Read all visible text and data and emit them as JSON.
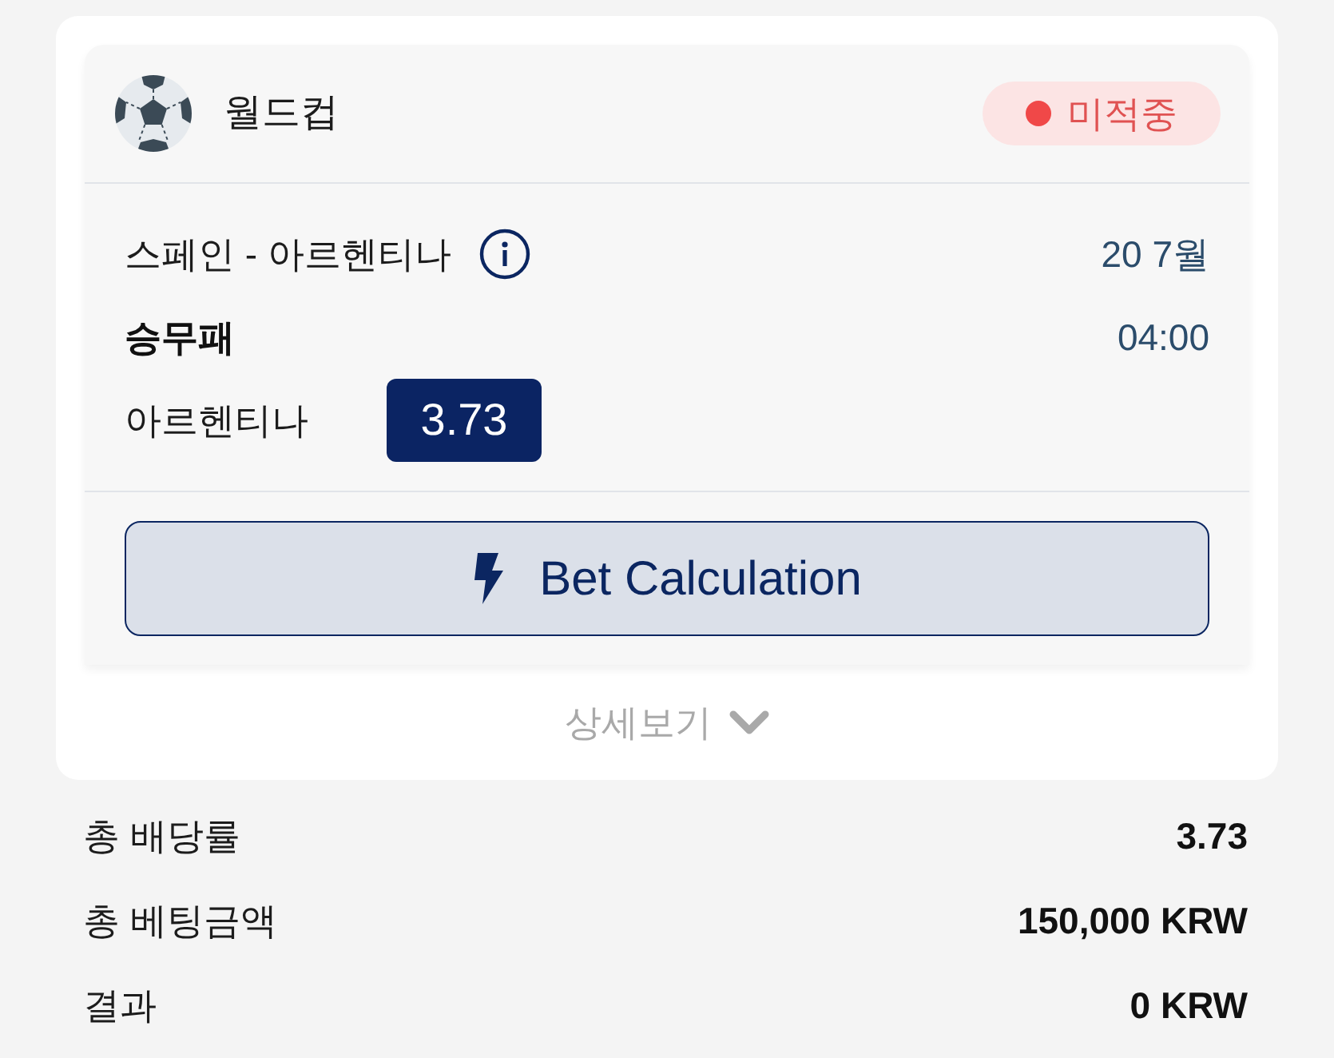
{
  "card": {
    "league": {
      "title": "월드컵"
    },
    "status_badge": {
      "label": "미적중"
    },
    "match": {
      "teams": "스페인 - 아르헨티나",
      "date": "20 7월",
      "market": "승무패",
      "time": "04:00",
      "pick": "아르헨티나",
      "odds": "3.73"
    },
    "action_button": {
      "label": "Bet Calculation"
    },
    "details_toggle": {
      "label": "상세보기",
      "expanded": false
    }
  },
  "summary": [
    {
      "label": "총 배당률",
      "value": "3.73"
    },
    {
      "label": "총 베팅금액",
      "value": "150,000 KRW"
    },
    {
      "label": "결과",
      "value": "0 KRW"
    }
  ]
}
